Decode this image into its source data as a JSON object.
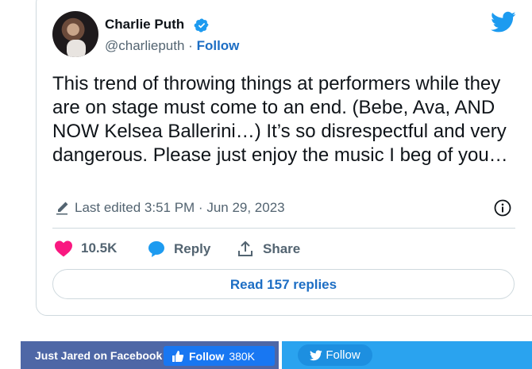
{
  "tweet": {
    "author_name": "Charlie Puth",
    "handle": "@charlieputh",
    "separator": "·",
    "follow_label": "Follow",
    "text": "This trend of throwing things at performers while they are on stage must come to an end. (Bebe, Ava, AND NOW Kelsea Ballerini…) It’s so disrespectful and very dangerous. Please just enjoy the music I beg of you…",
    "edited": "Last edited 3:51 PM · Jun 29, 2023",
    "likes": "10.5K",
    "reply_label": "Reply",
    "share_label": "Share",
    "read_replies_label": "Read 157 replies",
    "icons": [
      "verified-icon",
      "twitter-bird-icon",
      "pencil-icon",
      "info-icon",
      "heart-icon",
      "reply-bubble-icon",
      "share-icon"
    ],
    "colors": {
      "accent": "#1d9bf0",
      "link": "#1d6ec4",
      "like": "#f91880",
      "muted": "#536471"
    }
  },
  "footer": {
    "facebook": {
      "label": "Just Jared on Facebook",
      "follow_label": "Follow",
      "follow_count": "380K",
      "color": "#4e67a6"
    },
    "twitter": {
      "follow_label": "Follow",
      "color": "#2aa3ef"
    }
  }
}
